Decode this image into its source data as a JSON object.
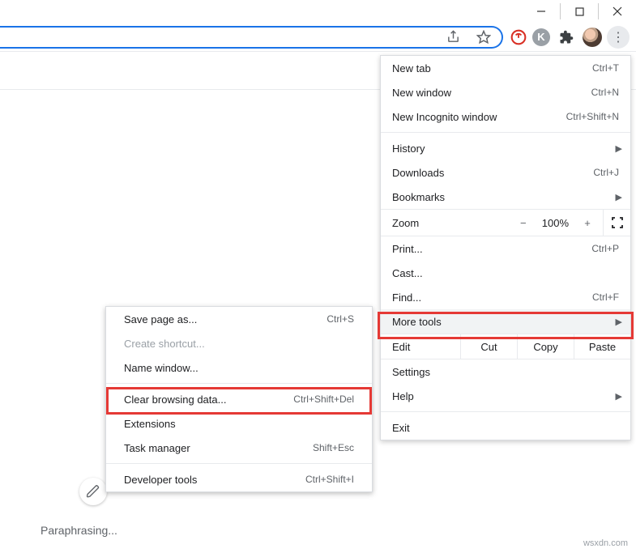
{
  "window_controls": {
    "minimize": "minimize",
    "maximize": "maximize",
    "close": "close"
  },
  "toolbar": {
    "share_icon": "share-icon",
    "star_icon": "star-icon",
    "ext_red_label": "",
    "ext_gray_label": "K",
    "puzzle_icon": "extensions-icon",
    "avatar": "user-avatar",
    "menu_icon": "kebab-menu"
  },
  "menu": {
    "new_tab": {
      "label": "New tab",
      "shortcut": "Ctrl+T"
    },
    "new_window": {
      "label": "New window",
      "shortcut": "Ctrl+N"
    },
    "new_incognito": {
      "label": "New Incognito window",
      "shortcut": "Ctrl+Shift+N"
    },
    "history": {
      "label": "History"
    },
    "downloads": {
      "label": "Downloads",
      "shortcut": "Ctrl+J"
    },
    "bookmarks": {
      "label": "Bookmarks"
    },
    "zoom": {
      "label": "Zoom",
      "minus": "−",
      "value": "100%",
      "plus": "+"
    },
    "print": {
      "label": "Print...",
      "shortcut": "Ctrl+P"
    },
    "cast": {
      "label": "Cast..."
    },
    "find": {
      "label": "Find...",
      "shortcut": "Ctrl+F"
    },
    "more_tools": {
      "label": "More tools"
    },
    "edit": {
      "label": "Edit",
      "cut": "Cut",
      "copy": "Copy",
      "paste": "Paste"
    },
    "settings": {
      "label": "Settings"
    },
    "help": {
      "label": "Help"
    },
    "exit": {
      "label": "Exit"
    }
  },
  "submenu": {
    "save_page": {
      "label": "Save page as...",
      "shortcut": "Ctrl+S"
    },
    "create_shortcut": {
      "label": "Create shortcut..."
    },
    "name_window": {
      "label": "Name window..."
    },
    "clear_data": {
      "label": "Clear browsing data...",
      "shortcut": "Ctrl+Shift+Del"
    },
    "extensions": {
      "label": "Extensions"
    },
    "task_manager": {
      "label": "Task manager",
      "shortcut": "Shift+Esc"
    },
    "dev_tools": {
      "label": "Developer tools",
      "shortcut": "Ctrl+Shift+I"
    }
  },
  "status_text": "Paraphrasing...",
  "watermark": "wsxdn.com"
}
